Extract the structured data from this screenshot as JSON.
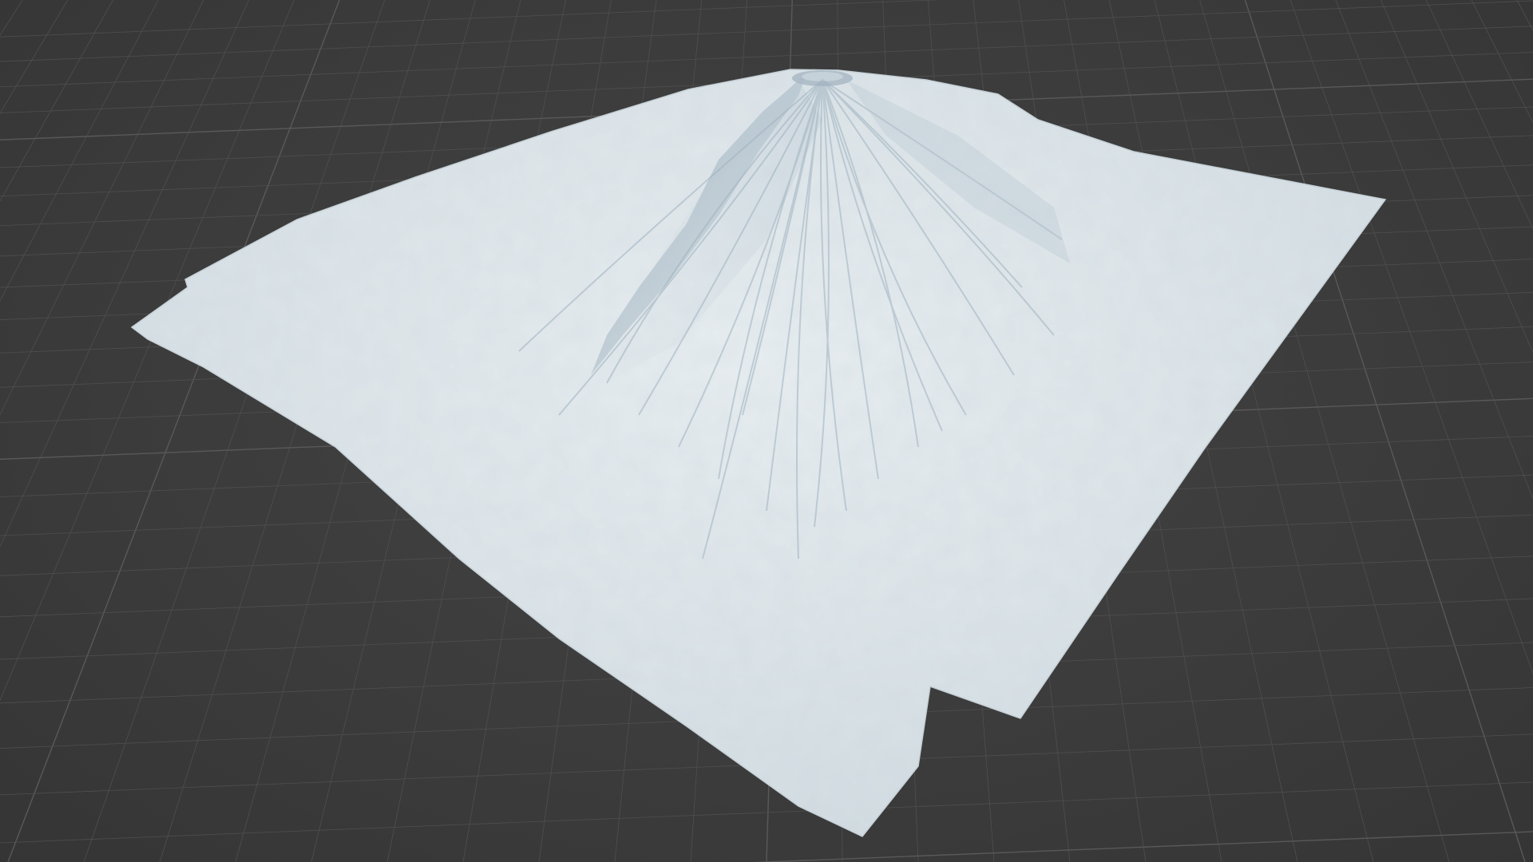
{
  "viewport": {
    "background_color": "#3d3d3d",
    "grid_color": "#4f4f4f",
    "grid_major_color": "#595959",
    "terrain_color": "#dbe3e7",
    "terrain_shadow_color": "#9fb0bc",
    "visible_text": "none"
  },
  "scene": {
    "object": "volcano-terrain-mesh",
    "shading": "solid"
  }
}
